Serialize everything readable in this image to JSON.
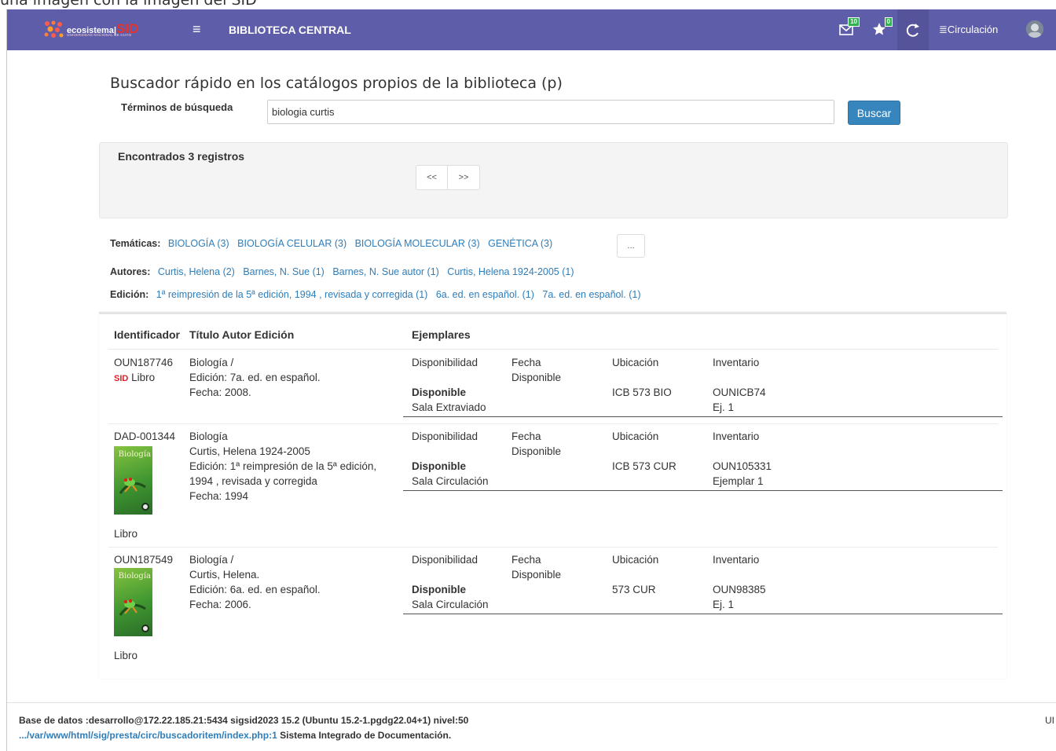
{
  "caption": "una imagen con la imagen del SID",
  "navbar": {
    "logo_text": "ecosistema",
    "logo_sid": "SID",
    "logo_subtitle": "UNIVERSIDAD NACIONAL DE CUYO",
    "title": "BIBLIOTECA CENTRAL",
    "mail_badge": "10",
    "star_badge": "0",
    "circulation_label": "Circulación",
    "colors": {
      "background": "#5e5da9",
      "badge": "#2fb14d"
    }
  },
  "search": {
    "heading": "Buscador rápido en los catálogos propios de la biblioteca (p)",
    "terms_label": "Términos de búsqueda",
    "value": "biologia curtis",
    "button_label": "Buscar"
  },
  "results": {
    "found_label": "Encontrados 3 registros",
    "prev_label": "<<",
    "next_label": ">>"
  },
  "facets": {
    "tematicas_label": "Temáticas:",
    "tematicas": [
      "BIOLOGÍA (3)",
      "BIOLOGÍA CELULAR (3)",
      "BIOLOGÍA MOLECULAR (3)",
      "GENÉTICA (3)"
    ],
    "more_label": "...",
    "autores_label": "Autores:",
    "autores": [
      "Curtis, Helena (2)",
      "Barnes, N. Sue (1)",
      "Barnes, N. Sue autor (1)",
      "Curtis, Helena 1924-2005 (1)"
    ],
    "edicion_label": "Edición:",
    "ediciones": [
      "1ª reimpresión de la 5ª edición, 1994 , revisada y corregida (1)",
      "6a. ed. en español. (1)",
      "7a. ed. en español. (1)"
    ]
  },
  "table": {
    "headers": {
      "identificador": "Identificador",
      "titulo": "Título Autor Edición",
      "ejemplares": "Ejemplares"
    },
    "sub_headers": {
      "disponibilidad": "Disponibilidad",
      "fecha": "Fecha",
      "disponible": "Disponible",
      "ubicacion": "Ubicación",
      "inventario": "Inventario"
    },
    "rows": [
      {
        "id": "OUN187746",
        "source_tag": "SID",
        "type": "Libro",
        "title_lines": [
          "Biología /",
          "Edición: 7a. ed. en español.",
          "Fecha: 2008."
        ],
        "status": "Disponible",
        "room": "Sala Extraviado",
        "location": "ICB 573 BIO",
        "inventory": "OUNICB74",
        "copy": "Ej. 1"
      },
      {
        "id": "DAD-001344",
        "cover_title": "Biología",
        "type": "Libro",
        "title_lines": [
          "Biología",
          "Curtis, Helena 1924-2005",
          "Edición: 1ª reimpresión de la 5ª edición,",
          "1994 , revisada y corregida",
          "Fecha: 1994"
        ],
        "status": "Disponible",
        "room": "Sala Circulación",
        "location": "ICB 573 CUR",
        "inventory": "OUN105331",
        "copy": "Ejemplar 1"
      },
      {
        "id": "OUN187549",
        "cover_title": "Biología",
        "type": "Libro",
        "title_lines": [
          "Biología /",
          "Curtis, Helena.",
          "Edición: 6a. ed. en español.",
          "Fecha: 2006."
        ],
        "status": "Disponible",
        "room": "Sala Circulación",
        "location": "573 CUR",
        "inventory": "OUN98385",
        "copy": "Ej. 1"
      }
    ]
  },
  "footer": {
    "db_line": "Base de datos :desarrollo@172.22.185.21:5434 sigsid2023 15.2 (Ubuntu 15.2-1.pgdg22.04+1) nivel:50",
    "path_link": ".../var/www/html/sig/presta/circ/buscadoritem/index.php:1",
    "system_name": "Sistema Integrado de Documentación.",
    "right_text": "UI"
  }
}
